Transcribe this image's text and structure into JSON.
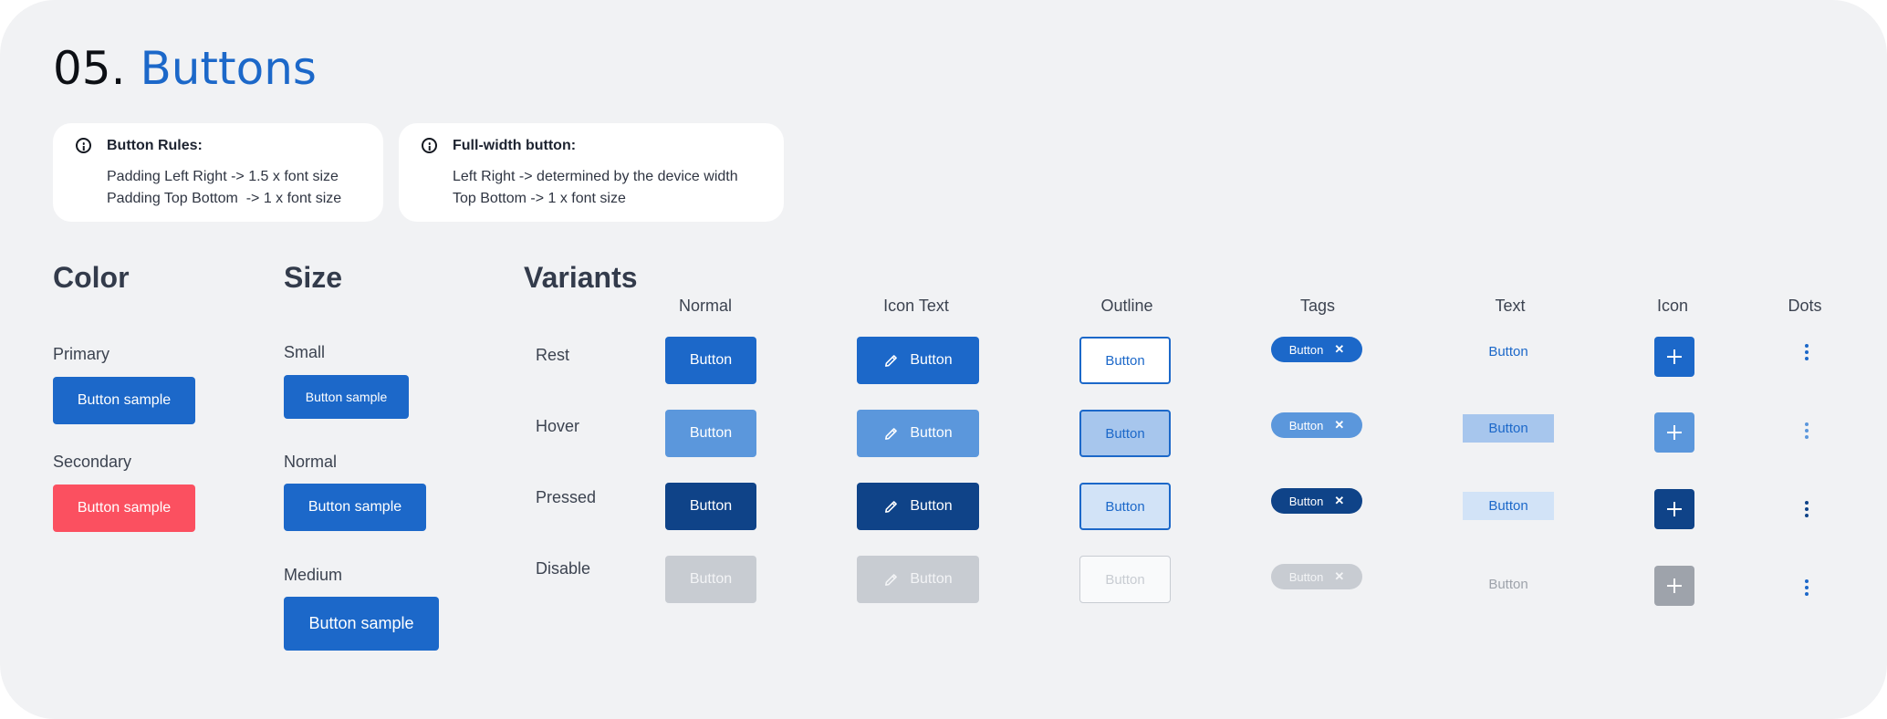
{
  "header": {
    "number": "05.",
    "title": "Buttons"
  },
  "notes": [
    {
      "title": "Button Rules:",
      "lines": [
        "Padding Left Right -> 1.5 x font size",
        "Padding Top Bottom  -> 1 x font size"
      ]
    },
    {
      "title": "Full-width button:",
      "lines": [
        "Left Right -> determined by the device width",
        "Top Bottom -> 1 x font size"
      ]
    }
  ],
  "color_section": {
    "title": "Color",
    "items": [
      {
        "label": "Primary",
        "button": "Button sample",
        "color": "#1c68c9"
      },
      {
        "label": "Secondary",
        "button": "Button sample",
        "color": "#fb5060"
      }
    ]
  },
  "size_section": {
    "title": "Size",
    "items": [
      {
        "label": "Small",
        "button": "Button sample"
      },
      {
        "label": "Normal",
        "button": "Button sample"
      },
      {
        "label": "Medium",
        "button": "Button sample"
      }
    ]
  },
  "variants": {
    "title": "Variants",
    "columns": [
      "Normal",
      "Icon Text",
      "Outline",
      "Tags",
      "Text",
      "Icon",
      "Dots"
    ],
    "states": [
      "Rest",
      "Hover",
      "Pressed",
      "Disable"
    ],
    "button_label": "Button",
    "icons": {
      "icon_text": "pencil-icon",
      "tag_close": "close-icon",
      "icon": "plus-icon",
      "dots": "more-vertical-icon"
    },
    "tag_close_glyph": "✕",
    "colors": {
      "rest": "#1c68c9",
      "hover": "#5b97dc",
      "pressed": "#0f4388",
      "disable": "#c8ccd2",
      "outline_hover_fill": "#a7c6ed",
      "outline_pressed_fill": "#d2e3f7",
      "text_hover_fill": "#a7c6ed",
      "text_pressed_fill": "#d2e3f7",
      "icon_disable": "#9ea3ab"
    }
  }
}
